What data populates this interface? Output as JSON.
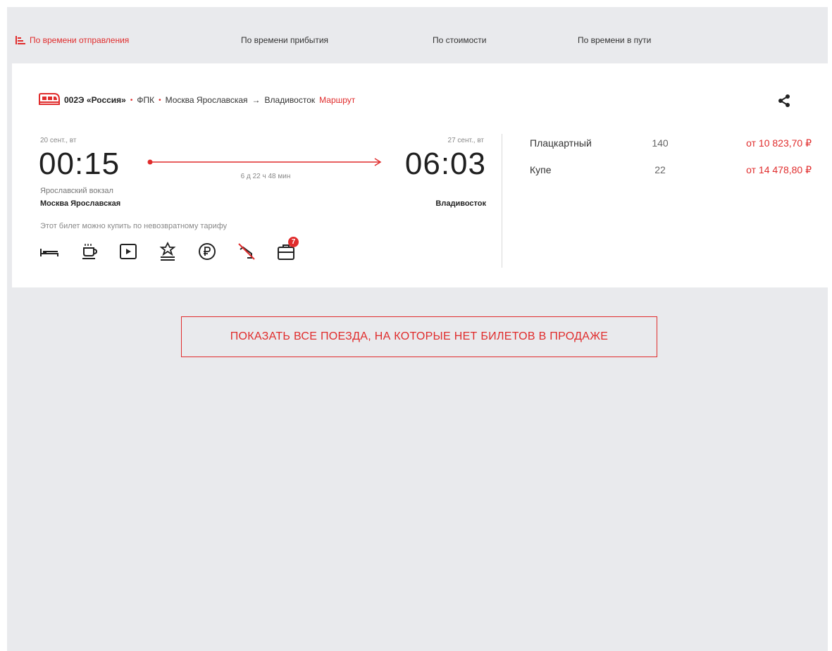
{
  "sort": {
    "departure": "По времени отправления",
    "arrival": "По времени прибытия",
    "price": "По стоимости",
    "duration": "По времени в пути"
  },
  "train": {
    "number": "002Э «Россия»",
    "carrier": "ФПК",
    "from": "Москва Ярославская",
    "arrow": "→",
    "to": "Владивосток",
    "route_link": "Маршрут",
    "dot": "•"
  },
  "departure": {
    "date": "20 сент., вт",
    "time": "00:15",
    "terminal": "Ярославский вокзал",
    "station": "Москва Ярославская"
  },
  "arrival": {
    "date": "27 сент., вт",
    "time": "06:03",
    "station": "Владивосток"
  },
  "duration": "6 д 22 ч 48 мин",
  "tariff_note": "Этот билет можно купить по невозвратному тарифу",
  "amenities": {
    "icons": [
      "bed-icon",
      "food-icon",
      "video-icon",
      "award-icon",
      "ruble-icon",
      "no-pets-icon",
      "luggage-icon"
    ],
    "luggage_badge": "7"
  },
  "classes": [
    {
      "name": "Плацкартный",
      "seats": "140",
      "price": "от 10 823,70 ₽"
    },
    {
      "name": "Купе",
      "seats": "22",
      "price": "от 14 478,80 ₽"
    }
  ],
  "show_all_button": "ПОКАЗАТЬ ВСЕ ПОЕЗДА, НА КОТОРЫЕ НЕТ БИЛЕТОВ В ПРОДАЖЕ",
  "colors": {
    "accent": "#e02c2c",
    "background": "#e9eaed",
    "card": "#ffffff"
  }
}
